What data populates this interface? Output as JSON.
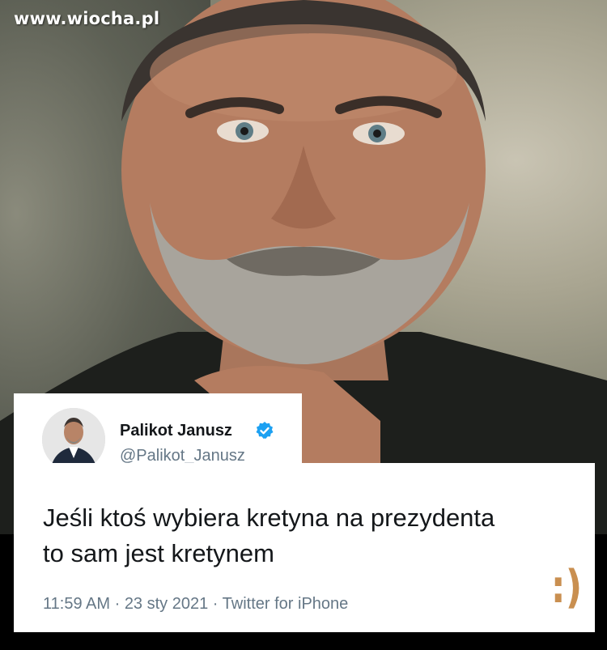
{
  "watermark": {
    "text": "www.wiocha.pl"
  },
  "tweet": {
    "display_name": "Palikot Janusz",
    "handle": "@Palikot_Janusz",
    "text_lines": [
      "Jeśli ktoś wybiera kretyna na prezydenta",
      "to sam jest kretynem"
    ],
    "time": "11:59 AM",
    "date": "23 sty 2021",
    "source": "Twitter for iPhone",
    "verified": true
  },
  "smiley": {
    "text": ":)"
  },
  "colors": {
    "verified_blue": "#1da1f2",
    "text_dark": "#14171a",
    "text_gray": "#657786",
    "smiley_orange": "#c98f50"
  },
  "icons": {
    "verified": "verified-badge-icon",
    "avatar": "avatar-photo"
  }
}
